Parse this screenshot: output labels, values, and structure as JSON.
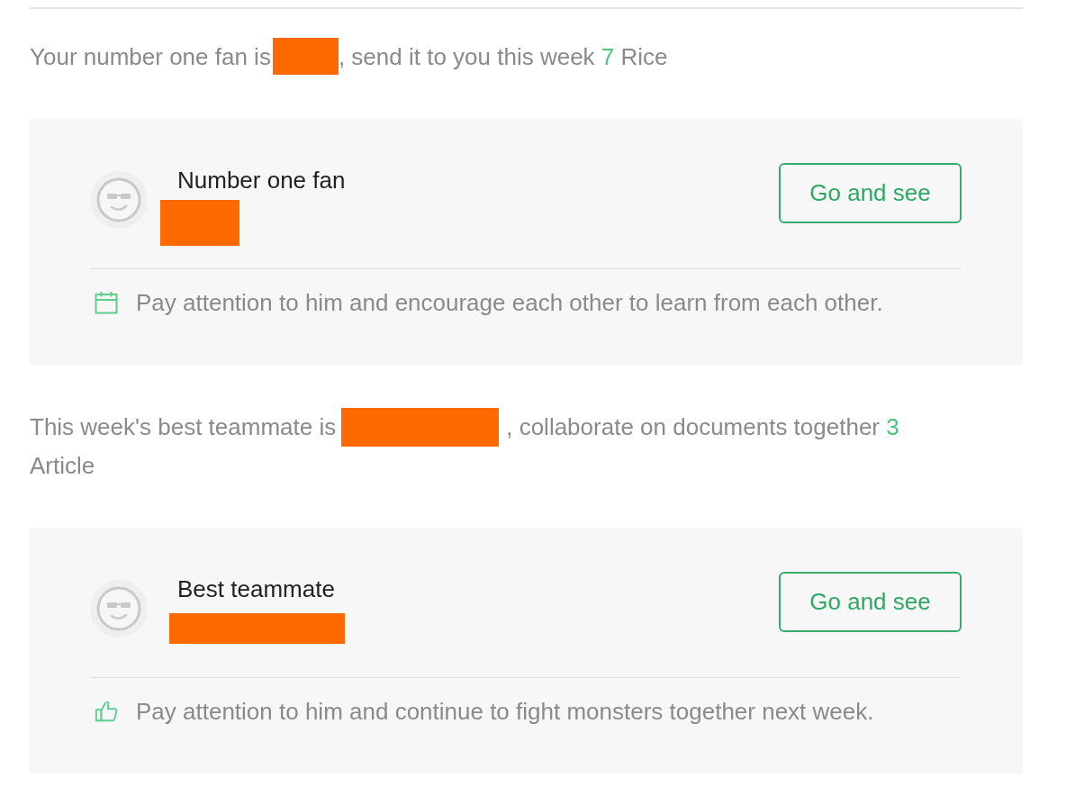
{
  "fan_section": {
    "summary": {
      "prefix": "Your number one fan is",
      "name_redacted": true,
      "suffix": ", send it to you this week",
      "count": "7",
      "unit": "Rice"
    },
    "card": {
      "title": "Number one fan",
      "name_redacted": true,
      "button": "Go and see",
      "note": "Pay attention to him and encourage each other to learn from each other."
    }
  },
  "teammate_section": {
    "summary": {
      "prefix": "This week's best teammate is",
      "name_redacted": true,
      "suffix": ", collaborate on documents together",
      "count": "3",
      "unit": "Article"
    },
    "card": {
      "title": "Best teammate",
      "name_redacted": true,
      "button": "Go and see",
      "note": "Pay attention to him and continue to fight monsters together next week."
    }
  }
}
